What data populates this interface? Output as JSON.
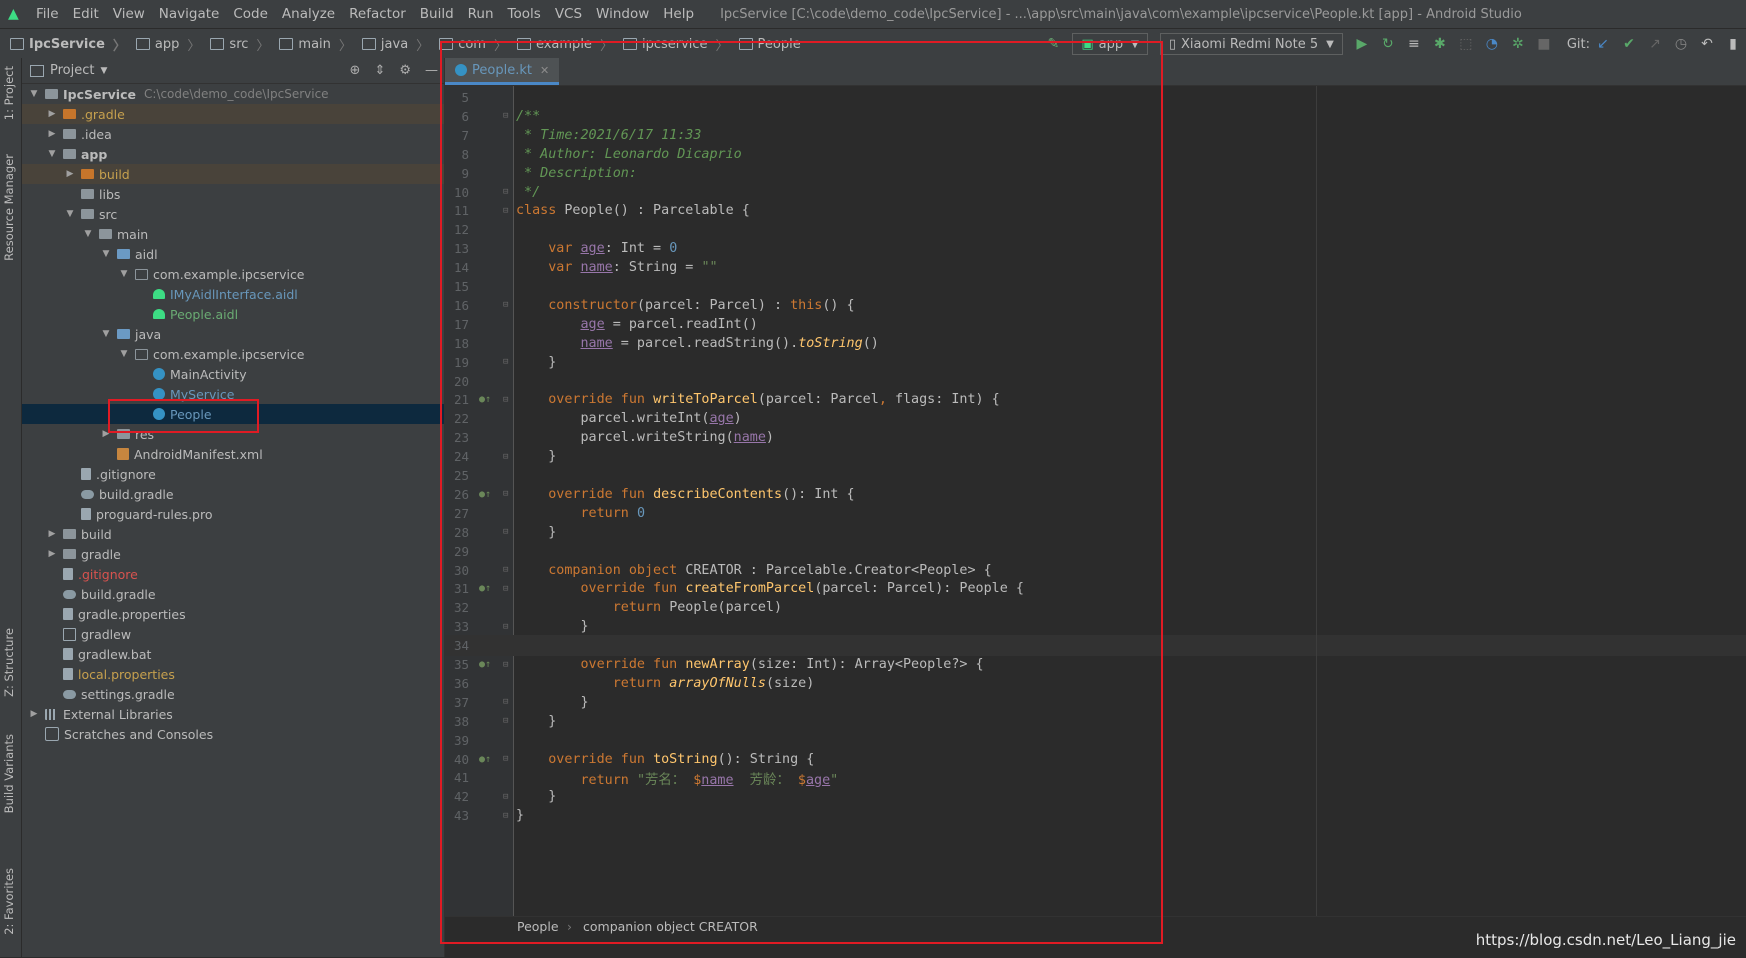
{
  "menu": {
    "items": [
      "File",
      "Edit",
      "View",
      "Navigate",
      "Code",
      "Analyze",
      "Refactor",
      "Build",
      "Run",
      "Tools",
      "VCS",
      "Window",
      "Help"
    ],
    "window_title": "IpcService [C:\\code\\demo_code\\IpcService] - ...\\app\\src\\main\\java\\com\\example\\ipcservice\\People.kt [app] - Android Studio"
  },
  "navbar": {
    "crumbs": [
      "IpcService",
      "app",
      "src",
      "main",
      "java",
      "com",
      "example",
      "ipcservice",
      "People"
    ],
    "run_config": "app",
    "device": "Xiaomi Redmi Note 5",
    "git_label": "Git:"
  },
  "left_strip": {
    "tabs": [
      "1: Project",
      "Resource Manager",
      "Z: Structure",
      "Build Variants",
      "2: Favorites"
    ]
  },
  "project_panel": {
    "title": "Project",
    "tree": [
      {
        "label": "IpcService",
        "path": "C:\\code\\demo_code\\IpcService",
        "depth": 0,
        "arrow": "open",
        "icon": "folder",
        "color": "default",
        "bold": true
      },
      {
        "label": ".gradle",
        "depth": 1,
        "arrow": "closed",
        "icon": "folder-orange",
        "color": "orange",
        "excluded": true
      },
      {
        "label": ".idea",
        "depth": 1,
        "arrow": "closed",
        "icon": "folder",
        "color": "default"
      },
      {
        "label": "app",
        "depth": 1,
        "arrow": "open",
        "icon": "folder",
        "color": "default",
        "bold": true
      },
      {
        "label": "build",
        "depth": 2,
        "arrow": "closed",
        "icon": "folder-orange",
        "color": "orange",
        "excluded": true
      },
      {
        "label": "libs",
        "depth": 2,
        "arrow": "none",
        "icon": "folder",
        "color": "default"
      },
      {
        "label": "src",
        "depth": 2,
        "arrow": "open",
        "icon": "folder",
        "color": "default"
      },
      {
        "label": "main",
        "depth": 3,
        "arrow": "open",
        "icon": "folder",
        "color": "default"
      },
      {
        "label": "aidl",
        "depth": 4,
        "arrow": "open",
        "icon": "folder-blue",
        "color": "default"
      },
      {
        "label": "com.example.ipcservice",
        "depth": 5,
        "arrow": "open",
        "icon": "package",
        "color": "default"
      },
      {
        "label": "IMyAidlInterface.aidl",
        "depth": 6,
        "arrow": "none",
        "icon": "android",
        "color": "blue"
      },
      {
        "label": "People.aidl",
        "depth": 6,
        "arrow": "none",
        "icon": "android",
        "color": "green"
      },
      {
        "label": "java",
        "depth": 4,
        "arrow": "open",
        "icon": "folder-blue",
        "color": "default"
      },
      {
        "label": "com.example.ipcservice",
        "depth": 5,
        "arrow": "open",
        "icon": "package",
        "color": "default"
      },
      {
        "label": "MainActivity",
        "depth": 6,
        "arrow": "none",
        "icon": "kotlin",
        "color": "default"
      },
      {
        "label": "MyService",
        "depth": 6,
        "arrow": "none",
        "icon": "kotlin",
        "color": "blue"
      },
      {
        "label": "People",
        "depth": 6,
        "arrow": "none",
        "icon": "kotlin",
        "color": "blue",
        "selected": true
      },
      {
        "label": "res",
        "depth": 4,
        "arrow": "closed",
        "icon": "folder",
        "color": "default"
      },
      {
        "label": "AndroidManifest.xml",
        "depth": 4,
        "arrow": "none",
        "icon": "xml",
        "color": "default"
      },
      {
        "label": ".gitignore",
        "depth": 2,
        "arrow": "none",
        "icon": "file",
        "color": "default"
      },
      {
        "label": "build.gradle",
        "depth": 2,
        "arrow": "none",
        "icon": "gradle",
        "color": "default"
      },
      {
        "label": "proguard-rules.pro",
        "depth": 2,
        "arrow": "none",
        "icon": "file",
        "color": "default"
      },
      {
        "label": "build",
        "depth": 1,
        "arrow": "closed",
        "icon": "folder",
        "color": "default"
      },
      {
        "label": "gradle",
        "depth": 1,
        "arrow": "closed",
        "icon": "folder",
        "color": "default"
      },
      {
        "label": ".gitignore",
        "depth": 1,
        "arrow": "none",
        "icon": "file",
        "color": "red"
      },
      {
        "label": "build.gradle",
        "depth": 1,
        "arrow": "none",
        "icon": "gradle",
        "color": "default"
      },
      {
        "label": "gradle.properties",
        "depth": 1,
        "arrow": "none",
        "icon": "file",
        "color": "default"
      },
      {
        "label": "gradlew",
        "depth": 1,
        "arrow": "none",
        "icon": "terminal",
        "color": "default"
      },
      {
        "label": "gradlew.bat",
        "depth": 1,
        "arrow": "none",
        "icon": "file",
        "color": "default"
      },
      {
        "label": "local.properties",
        "depth": 1,
        "arrow": "none",
        "icon": "file",
        "color": "orange"
      },
      {
        "label": "settings.gradle",
        "depth": 1,
        "arrow": "none",
        "icon": "gradle",
        "color": "default"
      },
      {
        "label": "External Libraries",
        "depth": 0,
        "arrow": "closed",
        "icon": "library",
        "color": "default"
      },
      {
        "label": "Scratches and Consoles",
        "depth": 0,
        "arrow": "none",
        "icon": "scratch",
        "color": "default"
      }
    ]
  },
  "editor": {
    "tab": "People.kt",
    "current_line": 34,
    "lines": [
      {
        "n": 5,
        "tokens": []
      },
      {
        "n": 6,
        "fold": true,
        "tokens": [
          [
            "cm",
            "/**"
          ]
        ]
      },
      {
        "n": 7,
        "tokens": [
          [
            "cm",
            " * Time:2021/6/17 11:33"
          ]
        ]
      },
      {
        "n": 8,
        "tokens": [
          [
            "cm",
            " * Author: Leonardo Dicaprio"
          ]
        ]
      },
      {
        "n": 9,
        "tokens": [
          [
            "cm",
            " * Description:"
          ]
        ]
      },
      {
        "n": 10,
        "fold": true,
        "tokens": [
          [
            "cm",
            " */"
          ]
        ]
      },
      {
        "n": 11,
        "fold": true,
        "tokens": [
          [
            "kw",
            "class "
          ],
          [
            "",
            "People() : Parcelable {"
          ]
        ]
      },
      {
        "n": 12,
        "tokens": []
      },
      {
        "n": 13,
        "tokens": [
          [
            "",
            "    "
          ],
          [
            "kw",
            "var "
          ],
          [
            "prop",
            "age"
          ],
          [
            "",
            ": Int = "
          ],
          [
            "num",
            "0"
          ]
        ]
      },
      {
        "n": 14,
        "tokens": [
          [
            "",
            "    "
          ],
          [
            "kw",
            "var "
          ],
          [
            "prop",
            "name"
          ],
          [
            "",
            ": String = "
          ],
          [
            "str",
            "\"\""
          ]
        ]
      },
      {
        "n": 15,
        "tokens": []
      },
      {
        "n": 16,
        "fold": true,
        "tokens": [
          [
            "",
            "    "
          ],
          [
            "kw",
            "constructor"
          ],
          [
            "",
            "(parcel: Parcel) : "
          ],
          [
            "kw",
            "this"
          ],
          [
            "",
            "() {"
          ]
        ]
      },
      {
        "n": 17,
        "tokens": [
          [
            "",
            "        "
          ],
          [
            "prop",
            "age"
          ],
          [
            "",
            " = parcel.readInt()"
          ]
        ]
      },
      {
        "n": 18,
        "tokens": [
          [
            "",
            "        "
          ],
          [
            "prop",
            "name"
          ],
          [
            "",
            " = parcel.readString()."
          ],
          [
            "it",
            "toString"
          ],
          [
            "",
            "()"
          ]
        ]
      },
      {
        "n": 19,
        "fold": true,
        "tokens": [
          [
            "",
            "    }"
          ]
        ]
      },
      {
        "n": 20,
        "tokens": []
      },
      {
        "n": 21,
        "mark": true,
        "fold": true,
        "tokens": [
          [
            "",
            "    "
          ],
          [
            "kw",
            "override fun "
          ],
          [
            "fn",
            "writeToParcel"
          ],
          [
            "",
            "(parcel: Parcel"
          ],
          [
            "kw",
            ", "
          ],
          [
            "",
            "flags: Int) {"
          ]
        ]
      },
      {
        "n": 22,
        "tokens": [
          [
            "",
            "        parcel.writeInt("
          ],
          [
            "prop",
            "age"
          ],
          [
            "",
            ")"
          ]
        ]
      },
      {
        "n": 23,
        "tokens": [
          [
            "",
            "        parcel.writeString("
          ],
          [
            "prop",
            "name"
          ],
          [
            "",
            ")"
          ]
        ]
      },
      {
        "n": 24,
        "fold": true,
        "tokens": [
          [
            "",
            "    }"
          ]
        ]
      },
      {
        "n": 25,
        "tokens": []
      },
      {
        "n": 26,
        "mark": true,
        "fold": true,
        "tokens": [
          [
            "",
            "    "
          ],
          [
            "kw",
            "override fun "
          ],
          [
            "fn",
            "describeContents"
          ],
          [
            "",
            "(): Int {"
          ]
        ]
      },
      {
        "n": 27,
        "tokens": [
          [
            "",
            "        "
          ],
          [
            "kw",
            "return "
          ],
          [
            "num",
            "0"
          ]
        ]
      },
      {
        "n": 28,
        "fold": true,
        "tokens": [
          [
            "",
            "    }"
          ]
        ]
      },
      {
        "n": 29,
        "tokens": []
      },
      {
        "n": 30,
        "fold": true,
        "tokens": [
          [
            "",
            "    "
          ],
          [
            "kw",
            "companion object "
          ],
          [
            "",
            "CREATOR : Parcelable.Creator<People> {"
          ]
        ]
      },
      {
        "n": 31,
        "mark": true,
        "fold": true,
        "tokens": [
          [
            "",
            "        "
          ],
          [
            "kw",
            "override fun "
          ],
          [
            "fn",
            "createFromParcel"
          ],
          [
            "",
            "(parcel: Parcel): People {"
          ]
        ]
      },
      {
        "n": 32,
        "tokens": [
          [
            "",
            "            "
          ],
          [
            "kw",
            "return "
          ],
          [
            "",
            "People(parcel)"
          ]
        ]
      },
      {
        "n": 33,
        "fold": true,
        "tokens": [
          [
            "",
            "        }"
          ]
        ]
      },
      {
        "n": 34,
        "tokens": []
      },
      {
        "n": 35,
        "mark": true,
        "fold": true,
        "tokens": [
          [
            "",
            "        "
          ],
          [
            "kw",
            "override fun "
          ],
          [
            "fn",
            "newArray"
          ],
          [
            "",
            "(size: Int): Array<People?> {"
          ]
        ]
      },
      {
        "n": 36,
        "tokens": [
          [
            "",
            "            "
          ],
          [
            "kw",
            "return "
          ],
          [
            "it",
            "arrayOfNulls"
          ],
          [
            "",
            "(size)"
          ]
        ]
      },
      {
        "n": 37,
        "fold": true,
        "tokens": [
          [
            "",
            "        }"
          ]
        ]
      },
      {
        "n": 38,
        "fold": true,
        "tokens": [
          [
            "",
            "    }"
          ]
        ]
      },
      {
        "n": 39,
        "tokens": []
      },
      {
        "n": 40,
        "mark": true,
        "fold": true,
        "tokens": [
          [
            "",
            "    "
          ],
          [
            "kw",
            "override fun "
          ],
          [
            "fn",
            "toString"
          ],
          [
            "",
            "(): String {"
          ]
        ]
      },
      {
        "n": 41,
        "tokens": [
          [
            "",
            "        "
          ],
          [
            "kw",
            "return "
          ],
          [
            "str",
            "\"芳名： "
          ],
          [
            "kw",
            "$"
          ],
          [
            "prop",
            "name"
          ],
          [
            "str",
            "  芳龄： "
          ],
          [
            "kw",
            "$"
          ],
          [
            "prop",
            "age"
          ],
          [
            "str",
            "\""
          ]
        ]
      },
      {
        "n": 42,
        "fold": true,
        "tokens": [
          [
            "",
            "    }"
          ]
        ]
      },
      {
        "n": 43,
        "fold": true,
        "tokens": [
          [
            "",
            "}"
          ]
        ]
      }
    ],
    "breadcrumb": [
      "People",
      "companion object CREATOR"
    ]
  },
  "watermark": "https://blog.csdn.net/Leo_Liang_jie",
  "colors": {
    "annotation": "#e01b24",
    "selection": "#0d293e",
    "accent": "#4a88c7"
  }
}
